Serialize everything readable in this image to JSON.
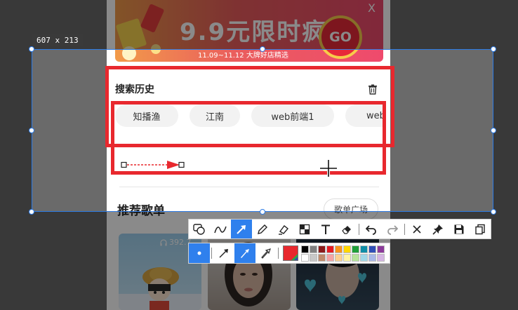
{
  "banner": {
    "title": "9.9元限时疯抢",
    "subtitle": "11.09~11.12 大牌好店精选",
    "go_label": "GO",
    "close_label": "X"
  },
  "search_history": {
    "title": "搜索历史",
    "delete_icon": "trash-icon",
    "chips": [
      "知播渔",
      "江南",
      "web前端1",
      "web"
    ]
  },
  "recommend": {
    "title": "推荐歌单",
    "square_button": "歌单广场",
    "play_count": "392.7"
  },
  "capture": {
    "size_label": "607 x 213",
    "border_color": "#2d7be5",
    "annotation_color": "#e8282e"
  },
  "toolbar": {
    "tools": [
      "rectangle-ellipse-icon",
      "freehand-icon",
      "arrow-icon",
      "pen-icon",
      "highlighter-icon",
      "mosaic-icon",
      "text-icon",
      "eraser-icon",
      "undo-icon",
      "redo-icon",
      "close-icon",
      "pin-icon",
      "save-icon",
      "copy-icon"
    ],
    "active_tool": "arrow-icon",
    "arrow_styles": [
      "dot-size",
      "line-arrow",
      "solid-arrow",
      "hollow-arrow"
    ],
    "current_color": "#e8282e",
    "palette": [
      "#000000",
      "#808080",
      "#8b1a1a",
      "#e31b23",
      "#f7941d",
      "#ffd700",
      "#1f9f3a",
      "#0e8ea8",
      "#2f4fb7",
      "#8b3a9a",
      "#ffffff",
      "#c8c8c8",
      "#c08a6b",
      "#f4a3a3",
      "#fcd08f",
      "#fff4a3",
      "#b5e39a",
      "#9fd8e8",
      "#a8b8e8",
      "#d5b5e3"
    ]
  }
}
